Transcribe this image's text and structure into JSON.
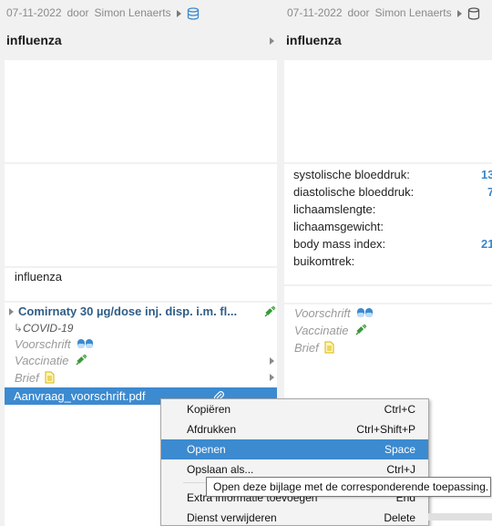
{
  "left": {
    "date": "07-11-2022",
    "by": "door",
    "author": "Simon Lenaerts",
    "title": "influenza",
    "diagnosis": "influenza",
    "medication": {
      "name": "Comirnaty 30 µg/dose inj. disp. i.m. fl...",
      "indication": "COVID-19",
      "prescription_label": "Voorschrift",
      "vaccination_label": "Vaccinatie",
      "letter_label": "Brief"
    },
    "attachment": "Aanvraag_voorschrift.pdf"
  },
  "right": {
    "date": "07-11-2022",
    "by": "door",
    "author": "Simon Lenaerts",
    "title": "influenza",
    "vitals": [
      {
        "label": "systolische bloeddruk:",
        "value": "13"
      },
      {
        "label": "diastolische bloeddruk:",
        "value": "7"
      },
      {
        "label": "lichaamslengte:",
        "value": ""
      },
      {
        "label": "lichaamsgewicht:",
        "value": ""
      },
      {
        "label": "body mass index:",
        "value": "21"
      },
      {
        "label": "buikomtrek:",
        "value": ""
      }
    ],
    "prescription_label": "Voorschrift",
    "vaccination_label": "Vaccinatie",
    "letter_label": "Brief"
  },
  "context_menu": [
    {
      "label": "Kopiëren",
      "shortcut": "Ctrl+C"
    },
    {
      "label": "Afdrukken",
      "shortcut": "Ctrl+Shift+P"
    },
    {
      "label": "Openen",
      "shortcut": "Space"
    },
    {
      "label": "Opslaan als...",
      "shortcut": "Ctrl+J"
    },
    {
      "label": "Extra informatie toevoegen",
      "shortcut": "End"
    },
    {
      "label": "Dienst verwijderen",
      "shortcut": "Delete"
    }
  ],
  "tooltip": "Open deze bijlage met de corresponderende toepassing.",
  "colors": {
    "accent": "#3c8ad0",
    "med_title": "#2e5d87",
    "vital_value": "#3a87c8",
    "syringe": "#3a9a3a"
  },
  "icons": [
    "play-arrow-icon",
    "database-icon",
    "pills-icon",
    "syringe-icon",
    "document-icon",
    "paperclip-icon",
    "chevron-right-icon"
  ]
}
